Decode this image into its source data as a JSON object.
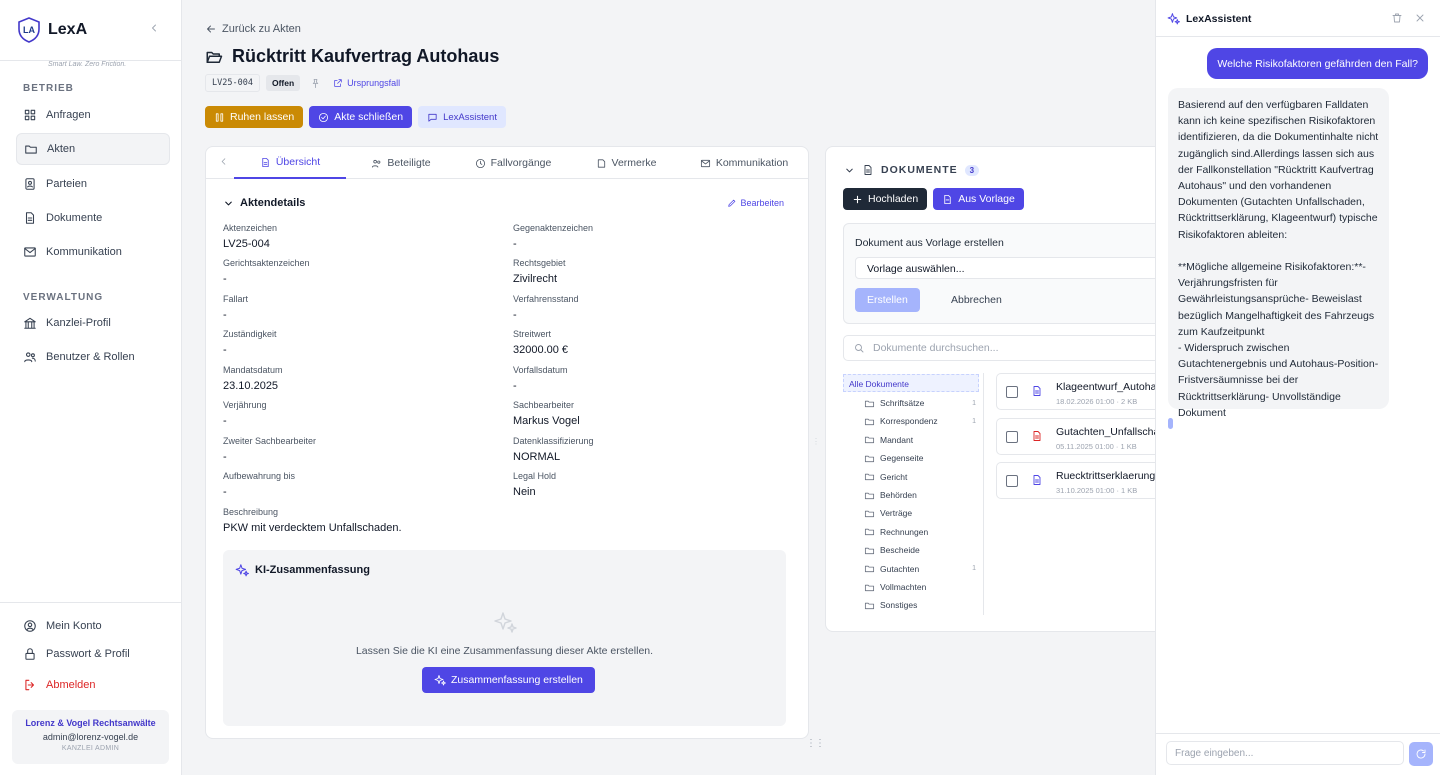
{
  "app": {
    "name": "LexA",
    "logo_mark": "LA",
    "slogan": "Smart Law. Zero Friction."
  },
  "sidebar": {
    "section_operations": "BETRIEB",
    "operations": [
      {
        "label": "Anfragen",
        "icon": "grid-icon"
      },
      {
        "label": "Akten",
        "icon": "folder-icon"
      },
      {
        "label": "Parteien",
        "icon": "contact-icon"
      },
      {
        "label": "Dokumente",
        "icon": "document-icon"
      },
      {
        "label": "Kommunikation",
        "icon": "mail-icon"
      }
    ],
    "section_admin": "VERWALTUNG",
    "admin": [
      {
        "label": "Kanzlei-Profil",
        "icon": "building-icon"
      },
      {
        "label": "Benutzer & Rollen",
        "icon": "users-icon"
      }
    ],
    "account": "Mein Konto",
    "password": "Passwort & Profil",
    "logout": "Abmelden",
    "firm": {
      "name": "Lorenz & Vogel Rechtsanwälte",
      "email": "admin@lorenz-vogel.de",
      "role": "KANZLEI ADMIN"
    }
  },
  "header": {
    "back": "Zurück zu Akten",
    "title": "Rücktritt Kaufvertrag Autohaus",
    "case_code": "LV25-004",
    "status": "Offen",
    "origin_link": "Ursprungsfall",
    "actions": {
      "rest": "Ruhen lassen",
      "close": "Akte schließen",
      "assistant": "LexAssistent"
    }
  },
  "tabs": [
    "Übersicht",
    "Beteiligte",
    "Fallvorgänge",
    "Vermerke",
    "Kommunikation"
  ],
  "details": {
    "heading": "Aktendetails",
    "edit": "Bearbeiten",
    "fields": [
      {
        "label": "Aktenzeichen",
        "value": "LV25-004"
      },
      {
        "label": "Gegenaktenzeichen",
        "value": "-"
      },
      {
        "label": "Gerichtsaktenzeichen",
        "value": "-"
      },
      {
        "label": "Rechtsgebiet",
        "value": "Zivilrecht"
      },
      {
        "label": "Fallart",
        "value": "-"
      },
      {
        "label": "Verfahrensstand",
        "value": "-"
      },
      {
        "label": "Zuständigkeit",
        "value": "-"
      },
      {
        "label": "Streitwert",
        "value": "32000.00 €"
      },
      {
        "label": "Mandatsdatum",
        "value": "23.10.2025"
      },
      {
        "label": "Vorfallsdatum",
        "value": "-"
      },
      {
        "label": "Verjährung",
        "value": "-"
      },
      {
        "label": "Sachbearbeiter",
        "value": "Markus Vogel"
      },
      {
        "label": "Zweiter Sachbearbeiter",
        "value": "-"
      },
      {
        "label": "Datenklassifizierung",
        "value": "NORMAL"
      },
      {
        "label": "Aufbewahrung bis",
        "value": "-"
      },
      {
        "label": "Legal Hold",
        "value": "Nein"
      },
      {
        "label": "Beschreibung",
        "value": "PKW mit verdecktem Unfallschaden."
      }
    ]
  },
  "ai_summary": {
    "heading": "KI-Zusammenfassung",
    "text": "Lassen Sie die KI eine Zusammenfassung dieser Akte erstellen.",
    "button": "Zusammenfassung erstellen"
  },
  "documents": {
    "heading": "DOKUMENTE",
    "count": "3",
    "upload": "Hochladen",
    "from_template": "Aus Vorlage",
    "template_title": "Dokument aus Vorlage erstellen",
    "template_select": "Vorlage auswählen...",
    "create": "Erstellen",
    "cancel": "Abbrechen",
    "search_placeholder": "Dokumente durchsuchen...",
    "all": "Alle Dokumente",
    "folders": [
      {
        "name": "Schriftsätze",
        "count": "1"
      },
      {
        "name": "Korrespondenz",
        "count": "1"
      },
      {
        "name": "Mandant",
        "count": ""
      },
      {
        "name": "Gegenseite",
        "count": ""
      },
      {
        "name": "Gericht",
        "count": ""
      },
      {
        "name": "Behörden",
        "count": ""
      },
      {
        "name": "Verträge",
        "count": ""
      },
      {
        "name": "Rechnungen",
        "count": ""
      },
      {
        "name": "Bescheide",
        "count": ""
      },
      {
        "name": "Gutachten",
        "count": "1"
      },
      {
        "name": "Vollmachten",
        "count": ""
      },
      {
        "name": "Sonstiges",
        "count": ""
      }
    ],
    "files": [
      {
        "name": "Klageentwurf_Autohaus",
        "meta": "18.02.2026 01:00 · 2 KB",
        "color": "#4f46e5"
      },
      {
        "name": "Gutachten_Unfallschaden",
        "meta": "05.11.2025 01:00 · 1 KB",
        "color": "#dc2626"
      },
      {
        "name": "Ruecktrittserklaerung_",
        "meta": "31.10.2025 01:00 · 1 KB",
        "color": "#4f46e5"
      }
    ]
  },
  "assistant": {
    "title": "LexAssistent",
    "user_message": "Welche Risikofaktoren gefährden den Fall?",
    "bot_message": "Basierend auf den verfügbaren Falldaten kann ich keine spezifischen Risikofaktoren identifizieren, da die Dokumentinhalte nicht zugänglich sind.Allerdings lassen sich aus der Fallkonstellation \"Rücktritt Kaufvertrag Autohaus\" und den vorhandenen Dokumenten (Gutachten Unfallschaden, Rücktrittserklärung, Klageentwurf) typische Risikofaktoren ableiten:\n\n**Mögliche allgemeine Risikofaktoren:**- Verjährungsfristen für Gewährleistungsansprüche- Beweislast bezüglich Mangelhaftigkeit des Fahrzeugs zum Kaufzeitpunkt\n- Widerspruch zwischen Gutachtenergebnis und Autohaus-Position- Fristversäumnisse bei der Rücktrittserklärung- Unvollständige Dokument",
    "input_placeholder": "Frage eingeben..."
  }
}
